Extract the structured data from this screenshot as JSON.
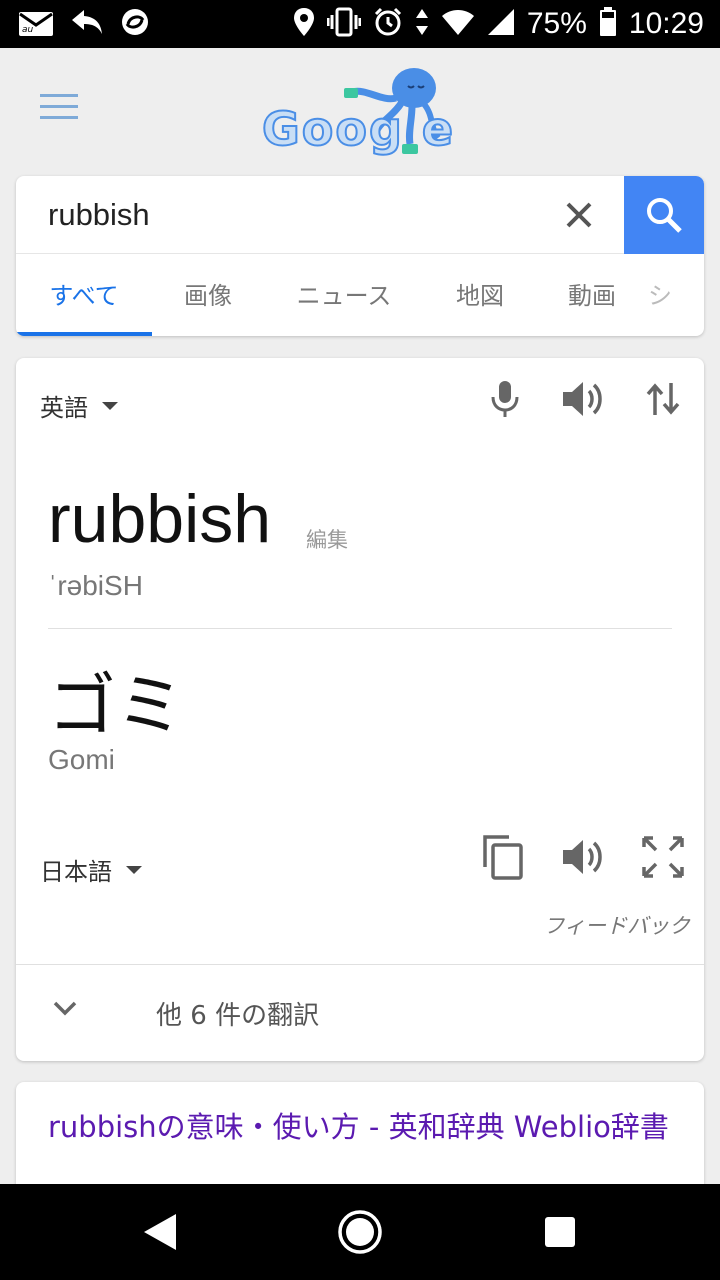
{
  "status_bar": {
    "battery": "75%",
    "time": "10:29",
    "icons": [
      "mail-icon",
      "reply-icon",
      "sync-icon",
      "location-icon",
      "vibrate-icon",
      "alarm-icon",
      "data-arrows-icon",
      "wifi-icon",
      "signal-icon",
      "battery-icon"
    ],
    "carrier_label": "au"
  },
  "header": {
    "logo_text": "Goog e"
  },
  "search": {
    "query": "rubbish",
    "tabs": [
      {
        "label": "すべて",
        "active": true
      },
      {
        "label": "画像"
      },
      {
        "label": "ニュース"
      },
      {
        "label": "地図"
      },
      {
        "label": "動画"
      },
      {
        "label": "シ"
      }
    ]
  },
  "translate": {
    "source_lang": "英語",
    "source_text": "rubbish",
    "edit_label": "編集",
    "phonetic": "ˈrəbiSH",
    "target_text": "ゴミ",
    "romanized": "Gomi",
    "target_lang": "日本語",
    "feedback_label": "フィードバック",
    "more_label": "他 6 件の翻訳"
  },
  "result": {
    "title": "rubbishの意味・使い方 - 英和辞典 Weblio辞書"
  },
  "colors": {
    "accent_blue": "#4285f4",
    "tab_active": "#1a73e8",
    "link_purple": "#5b1ab0"
  }
}
